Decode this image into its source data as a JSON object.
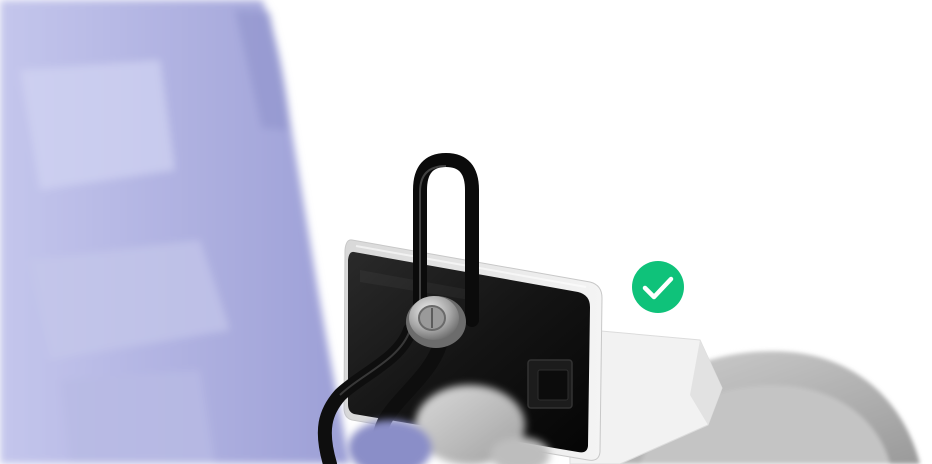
{
  "scene": {
    "background": "#ffffff",
    "foreground_panel_color": "#aeb0e0",
    "device_body_color": "#121212",
    "device_frame_color": "#e6e6e6",
    "lock_shackle_color": "#111111",
    "lock_knob_color": "#b8b8b8",
    "wheel_color": "#b5b5b5",
    "status_badge": {
      "state": "success",
      "color": "#0fc27a",
      "icon": "checkmark-icon"
    }
  }
}
